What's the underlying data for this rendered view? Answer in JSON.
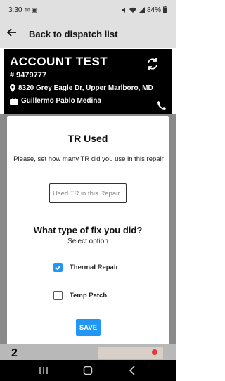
{
  "status_bar": {
    "time": "3:30",
    "battery": "84%",
    "icons": [
      "mail-icon",
      "image-icon",
      "mute-icon",
      "wifi-icon",
      "signal-icon",
      "battery-icon"
    ]
  },
  "header": {
    "title": "Back to dispatch list",
    "back_icon": "back-arrow-icon"
  },
  "account": {
    "name": "ACCOUNT TEST",
    "number": "# 9479777",
    "address": "8320 Grey Eagle Dr, Upper Marlboro, MD",
    "technician": "Guillermo Pablo Medina"
  },
  "modal": {
    "title": "TR Used",
    "instruction": "Please, set how many TR did you use in this repair",
    "tr_input": {
      "placeholder": "Used TR in this Repair",
      "value": ""
    },
    "fix_title": "What type of fix you did?",
    "fix_subtitle": "Select option",
    "options": [
      {
        "label": "Thermal Repair",
        "checked": true
      },
      {
        "label": "Temp Patch",
        "checked": false
      }
    ],
    "save_label": "SAVE"
  },
  "background_list": {
    "next_item_number": "2"
  },
  "colors": {
    "accent": "#2196f3",
    "card_bg": "#000000",
    "overlay": "#8a8a8a"
  }
}
